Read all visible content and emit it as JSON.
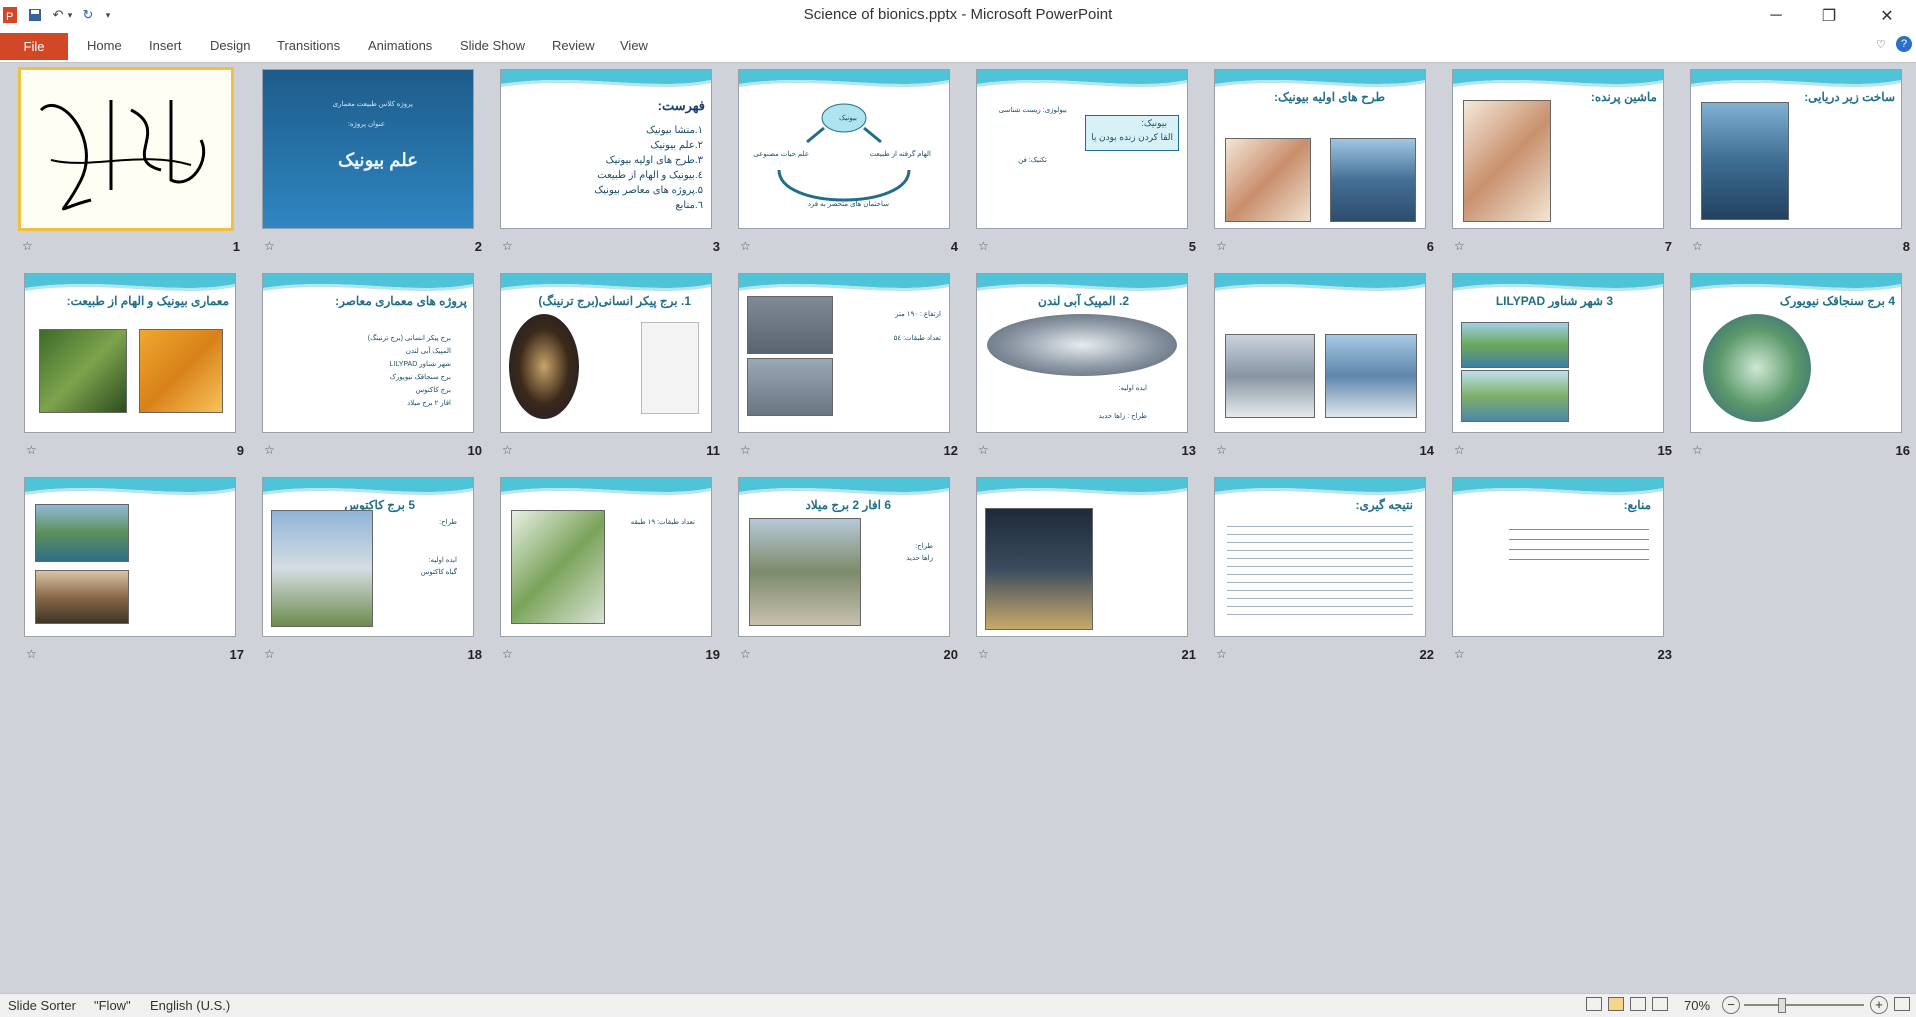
{
  "window": {
    "title": "Science of bionics.pptx - Microsoft PowerPoint"
  },
  "ribbon": {
    "file_label": "File",
    "tabs": [
      "Home",
      "Insert",
      "Design",
      "Transitions",
      "Animations",
      "Slide Show",
      "Review",
      "View"
    ]
  },
  "colors": {
    "file_tab": "#d24726",
    "accent": "#1f6f8b",
    "selection": "#f0c040"
  },
  "slides": [
    {
      "num": "1",
      "title": "",
      "lines": []
    },
    {
      "num": "2",
      "title": "علم بیونیک",
      "lines": [
        "پروژه کلاس طبیعت معماری",
        "عنوان پروژه:"
      ]
    },
    {
      "num": "3",
      "title": "فهرست:",
      "lines": [
        "۱.منشا بیونیک",
        "۲.علم بیونیک",
        "۳.طرح های اولیه بیونیک",
        "٤.بیونیک و الهام از طبیعت",
        "۵.پروژه های معاصر بیونیک",
        "٦.منابع"
      ]
    },
    {
      "num": "4",
      "title": "",
      "lines": [
        "بیونیک",
        "الهام گرفته از طبیعت",
        "علم حیات مصنوعی",
        "ساختمان های متحصر به فرد"
      ]
    },
    {
      "num": "5",
      "title": "",
      "lines": [
        "بیونیک:",
        "القا کردن زنده بودن یا",
        "بیولوژی: زیست شناسی",
        "تکنیک: فن"
      ]
    },
    {
      "num": "6",
      "title": "طرح های اولیه بیونیک:",
      "lines": []
    },
    {
      "num": "7",
      "title": "ماشین پرنده:",
      "lines": []
    },
    {
      "num": "8",
      "title": "ساخت زیر دریایی:",
      "lines": []
    },
    {
      "num": "9",
      "title": "معماری بیونیک و الهام از طبیعت:",
      "lines": []
    },
    {
      "num": "10",
      "title": "پروژه های معماری معاصر:",
      "lines": [
        "برج پیکر انسانی (برج ترنینگ)",
        "المپیک آبی لندن",
        "شهر شناور LILYPAD",
        "برج سنجاقک نیویورک",
        "برج کاکتوس",
        "افار ۲ برج میلاد"
      ]
    },
    {
      "num": "11",
      "title": "1. برج پیکر انسانی(برج ترنینگ)",
      "lines": []
    },
    {
      "num": "12",
      "title": "",
      "lines": [
        "ارتفاع : ۱۹۰ متر",
        "تعداد طبقات: ۵٤"
      ]
    },
    {
      "num": "13",
      "title": "2. المپیک آبی لندن",
      "lines": [
        "ایده اولیه:",
        "طراح : زاها حدید"
      ]
    },
    {
      "num": "14",
      "title": "",
      "lines": []
    },
    {
      "num": "15",
      "title": "3 شهر شناور LILYPAD",
      "lines": []
    },
    {
      "num": "16",
      "title": "4 برج سنجاقک نیویورک",
      "lines": []
    },
    {
      "num": "17",
      "title": "",
      "lines": []
    },
    {
      "num": "18",
      "title": "5 برج کاکتوس",
      "lines": [
        "طراح:",
        "ایده اولیه:",
        "گیاه کاکتوس"
      ]
    },
    {
      "num": "19",
      "title": "",
      "lines": [
        "تعداد طبقات: ۱۹ طبقه"
      ]
    },
    {
      "num": "20",
      "title": "6 افار 2 برج میلاد",
      "lines": [
        "طراح:",
        "زاها حدید"
      ]
    },
    {
      "num": "21",
      "title": "",
      "lines": []
    },
    {
      "num": "22",
      "title": "نتیجه گیری:",
      "lines": []
    },
    {
      "num": "23",
      "title": "منابع:",
      "lines": []
    }
  ],
  "status": {
    "view": "Slide Sorter",
    "theme": "\"Flow\"",
    "language": "English (U.S.)",
    "zoom": "70%",
    "zoom_level": 0.7
  }
}
